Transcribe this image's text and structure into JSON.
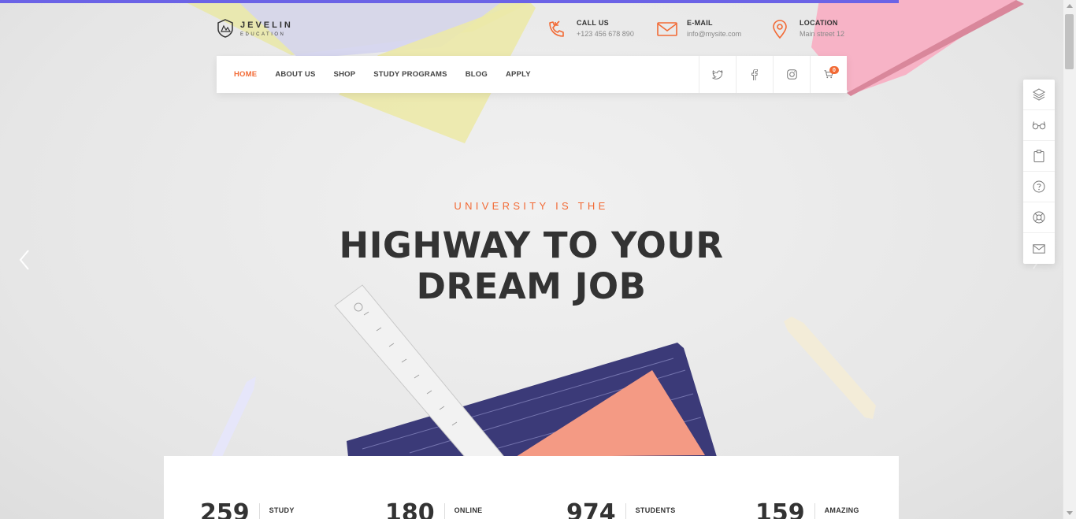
{
  "logo": {
    "title": "JEVELIN",
    "subtitle": "EDUCATION"
  },
  "contacts": [
    {
      "label": "CALL US",
      "value": "+123 456 678 890",
      "icon": "phone-icon"
    },
    {
      "label": "E-MAIL",
      "value": "info@mysite.com",
      "icon": "mail-icon"
    },
    {
      "label": "LOCATION",
      "value": "Main street 12",
      "icon": "map-pin-icon"
    }
  ],
  "nav": {
    "items": [
      "HOME",
      "ABOUT US",
      "SHOP",
      "STUDY PROGRAMS",
      "BLOG",
      "APPLY"
    ],
    "active": "HOME",
    "social": [
      "twitter-icon",
      "facebook-icon",
      "instagram-icon"
    ],
    "cart_count": "0"
  },
  "hero": {
    "eyebrow": "UNIVERSITY IS THE",
    "headline_line1": "HIGHWAY TO YOUR",
    "headline_line2": "DREAM JOB"
  },
  "side_toolbar": [
    "layers-icon",
    "glasses-icon",
    "clipboard-icon",
    "help-icon",
    "lifebuoy-icon",
    "envelope-icon"
  ],
  "stats": [
    {
      "number": "259",
      "label": "STUDY"
    },
    {
      "number": "180",
      "label": "ONLINE"
    },
    {
      "number": "974",
      "label": "STUDENTS"
    },
    {
      "number": "159",
      "label": "AMAZING"
    }
  ],
  "colors": {
    "accent": "#f26a35",
    "progress": "#6b63e6",
    "text": "#333333"
  }
}
